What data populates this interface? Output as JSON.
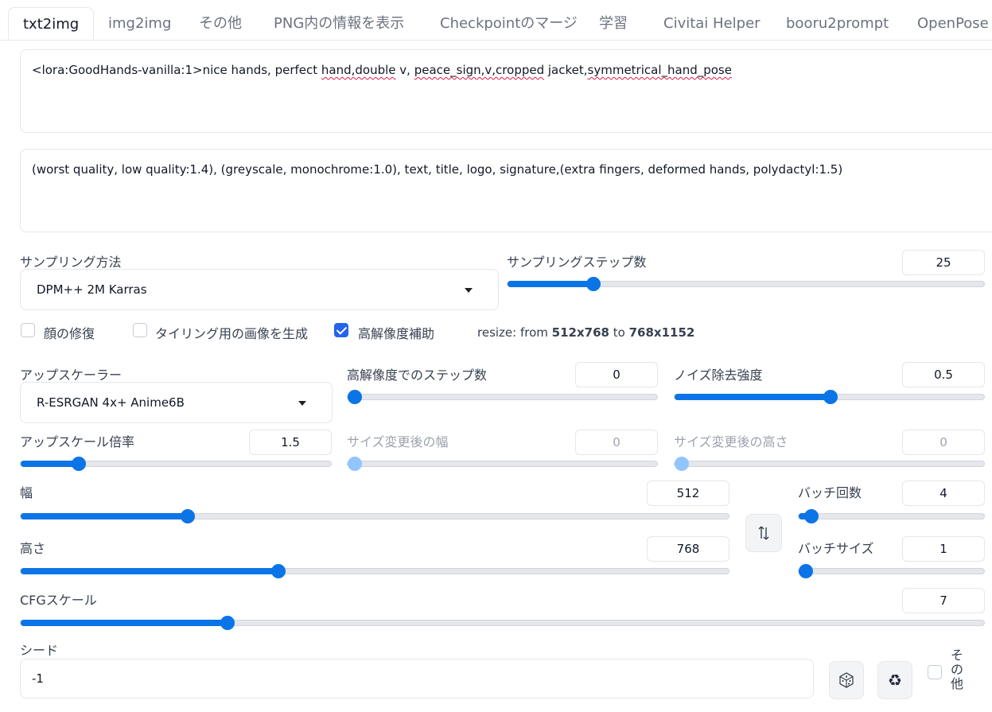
{
  "tabs": [
    "txt2img",
    "img2img",
    "その他",
    "PNG内の情報を表示",
    "Checkpointのマージ",
    "学習",
    "Civitai Helper",
    "booru2prompt",
    "OpenPose E"
  ],
  "prompt": {
    "p1": "<lora:GoodHands-vanilla:1>nice hands, perfect ",
    "p2": "hand,double",
    "p3": " v, ",
    "p4": "peace_sign,v,cropped",
    "p5": " jacket,",
    "p6": "symmetrical_hand_pose"
  },
  "negative_prompt": "(worst quality, low quality:1.4), (greyscale, monochrome:1.0), text, title, logo, signature,(extra fingers, deformed hands, polydactyl:1.5)",
  "sampler": {
    "label": "サンプリング方法",
    "value": "DPM++ 2M Karras"
  },
  "steps": {
    "label": "サンプリングステップ数",
    "value": "25",
    "fraction": 0.17
  },
  "checkboxes": {
    "face": "顔の修復",
    "tiling": "タイリング用の画像を生成",
    "hires": "高解像度補助"
  },
  "resize": {
    "prefix": "resize: from ",
    "from": "512x768",
    "mid": " to ",
    "to": "768x1152"
  },
  "upscaler": {
    "label": "アップスケーラー",
    "value": "R-ESRGAN 4x+ Anime6B"
  },
  "hires_steps": {
    "label": "高解像度でのステップ数",
    "value": "0",
    "fraction": 0.0
  },
  "denoise": {
    "label": "ノイズ除去強度",
    "value": "0.5",
    "fraction": 0.5
  },
  "upscale_by": {
    "label": "アップスケール倍率",
    "value": "1.5",
    "fraction": 0.17
  },
  "resize_w": {
    "label": "サイズ変更後の幅",
    "value": "0",
    "fraction": 0.0
  },
  "resize_h": {
    "label": "サイズ変更後の高さ",
    "value": "0",
    "fraction": 0.0
  },
  "width": {
    "label": "幅",
    "value": "512",
    "fraction": 0.23
  },
  "height": {
    "label": "高さ",
    "value": "768",
    "fraction": 0.36
  },
  "batch_count": {
    "label": "バッチ回数",
    "value": "4",
    "fraction": 0.03
  },
  "batch_size": {
    "label": "バッチサイズ",
    "value": "1",
    "fraction": 0.0
  },
  "cfg": {
    "label": "CFGスケール",
    "value": "7",
    "fraction": 0.21
  },
  "seed": {
    "label": "シード",
    "value": "-1"
  },
  "extra_label": "その他",
  "icons": {
    "swap": "swap-arrows-icon",
    "dice": "dice-icon",
    "recycle": "recycle-icon"
  }
}
